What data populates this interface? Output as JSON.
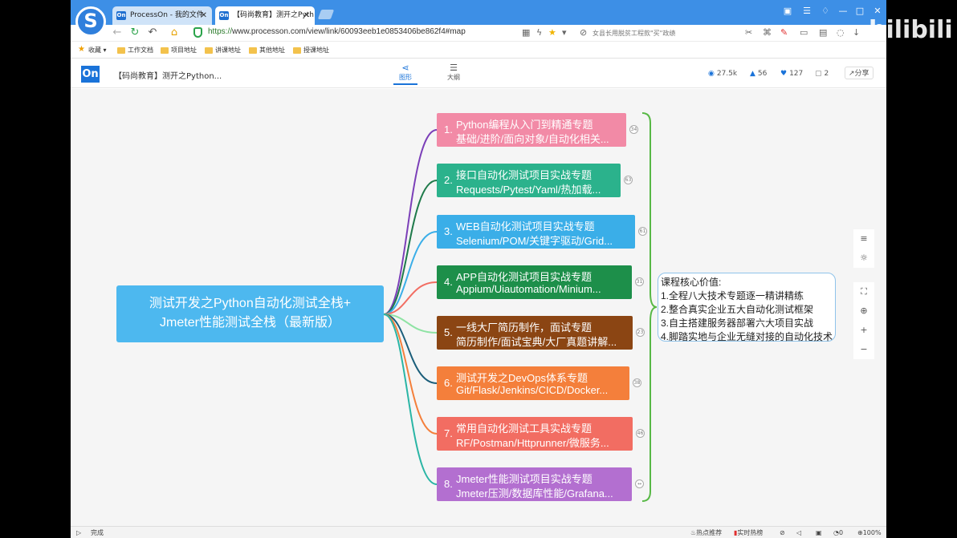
{
  "browser": {
    "logo": "S",
    "tabs": [
      {
        "label": "ProcessOn - 我的文件",
        "favicon": "On"
      },
      {
        "label": "【码尚教育】测开之Pyth",
        "favicon": "On"
      }
    ],
    "url_secure": "https://",
    "url_rest": "www.processon.com/view/link/60093eeb1e0853406be862f4#map",
    "search_hint": "女县长用脱贫工程款\"买\"政绩",
    "bookmarks": [
      {
        "label": "收藏",
        "icon": "star-icon"
      },
      {
        "label": "工作文档",
        "icon": "folder-icon"
      },
      {
        "label": "项目地址",
        "icon": "folder-icon"
      },
      {
        "label": "讲课地址",
        "icon": "folder-icon"
      },
      {
        "label": "其他地址",
        "icon": "folder-icon"
      },
      {
        "label": "授课地址",
        "icon": "folder-icon"
      }
    ],
    "status_text": "完成",
    "status_items": [
      "热点推荐",
      "实时热榜",
      "0",
      "100%"
    ]
  },
  "app": {
    "logo": "On",
    "title": "【码尚教育】测开之Python...",
    "view_tabs": [
      "图形",
      "大纲"
    ],
    "stats": {
      "views": "27.5k",
      "likes": "56",
      "favorites": "127",
      "comments": "2"
    },
    "share_label": "分享"
  },
  "mindmap": {
    "root_line1": "测试开发之Python自动化测试全栈+",
    "root_line2": "Jmeter性能测试全栈（最新版）",
    "branches": [
      {
        "num": "1.",
        "line1": "Python编程从入门到精通专题",
        "line2": "基础/进阶/面向对象/自动化相关...",
        "color": "#f28aa6",
        "badge": "34"
      },
      {
        "num": "2.",
        "line1": "接口自动化测试项目实战专题",
        "line2": "Requests/Pytest/Yaml/热加载...",
        "color": "#2bb28c",
        "badge": "63"
      },
      {
        "num": "3.",
        "line1": "WEB自动化测试项目实战专题",
        "line2": "Selenium/POM/关键字驱动/Grid...",
        "color": "#3aaee8",
        "badge": "61"
      },
      {
        "num": "4.",
        "line1": "APP自动化测试项目实战专题",
        "line2": "Appium/Uiautomation/Minium...",
        "color": "#1d8f4a",
        "badge": "31"
      },
      {
        "num": "5.",
        "line1": "一线大厂简历制作，面试专题",
        "line2": "简历制作/面试宝典/大厂真题讲解...",
        "color": "#8b4513",
        "badge": "23"
      },
      {
        "num": "6.",
        "line1": "测试开发之DevOps体系专题",
        "line2": "Git/Flask/Jenkins/CICD/Docker...",
        "color": "#f47f3b",
        "badge": "38"
      },
      {
        "num": "7.",
        "line1": "常用自动化测试工具实战专题",
        "line2": "RF/Postman/Httprunner/微服务...",
        "color": "#f26d62",
        "badge": "46"
      },
      {
        "num": "8.",
        "line1": "Jmeter性能测试项目实战专题",
        "line2": "Jmeter压测/数据库性能/Grafana...",
        "color": "#b36fd0",
        "badge": "↔"
      }
    ],
    "value_box": {
      "title": "课程核心价值:",
      "items": [
        "1.全程八大技术专题逐一精讲精练",
        "2.整合真实企业五大自动化测试框架",
        "3.自主搭建服务器部署六大项目实战",
        "4.脚踏实地与企业无缝对接的自动化技术"
      ]
    },
    "connector_colors": [
      "#7b3fb8",
      "#1f7a4a",
      "#3aaee8",
      "#f26d62",
      "#8fe3a4",
      "#1b5e7a",
      "#f47f3b",
      "#2ab5a5"
    ]
  },
  "watermark": "bilibili"
}
